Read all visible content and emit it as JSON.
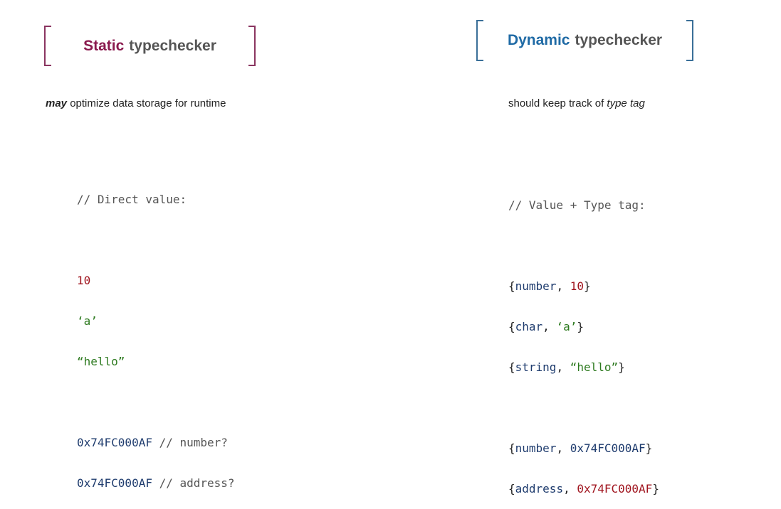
{
  "static": {
    "title_accent": "Static",
    "title_rest": "typechecker",
    "subtitle_em": "may",
    "subtitle_rest": " optimize data storage for runtime",
    "comment": "// Direct value:",
    "values": [
      "10",
      "‘a’",
      "“hello”"
    ],
    "addr_lines": [
      {
        "value": "0x74FC000AF",
        "comment": " // number?"
      },
      {
        "value": "0x74FC000AF",
        "comment": " // address?"
      }
    ]
  },
  "dynamic": {
    "title_accent": "Dynamic",
    "title_rest": "typechecker",
    "subtitle_rest": "should keep track of ",
    "subtitle_em": "type tag",
    "comment": "// Value + Type tag:",
    "tagged": [
      {
        "tag": "number",
        "value": "10"
      },
      {
        "tag": "char",
        "value": "‘a’"
      },
      {
        "tag": "string",
        "value": "“hello”"
      }
    ],
    "tagged_addr": [
      {
        "tag": "number",
        "value": "0x74FC000AF"
      },
      {
        "tag": "address",
        "value": "0x74FC000AF"
      }
    ]
  },
  "colors": {
    "static_accent": "#8a1a4e",
    "dynamic_accent": "#1f6aa5",
    "value_red": "#a0141e",
    "value_green": "#2d7a1f",
    "value_navy": "#1f3c6e"
  }
}
